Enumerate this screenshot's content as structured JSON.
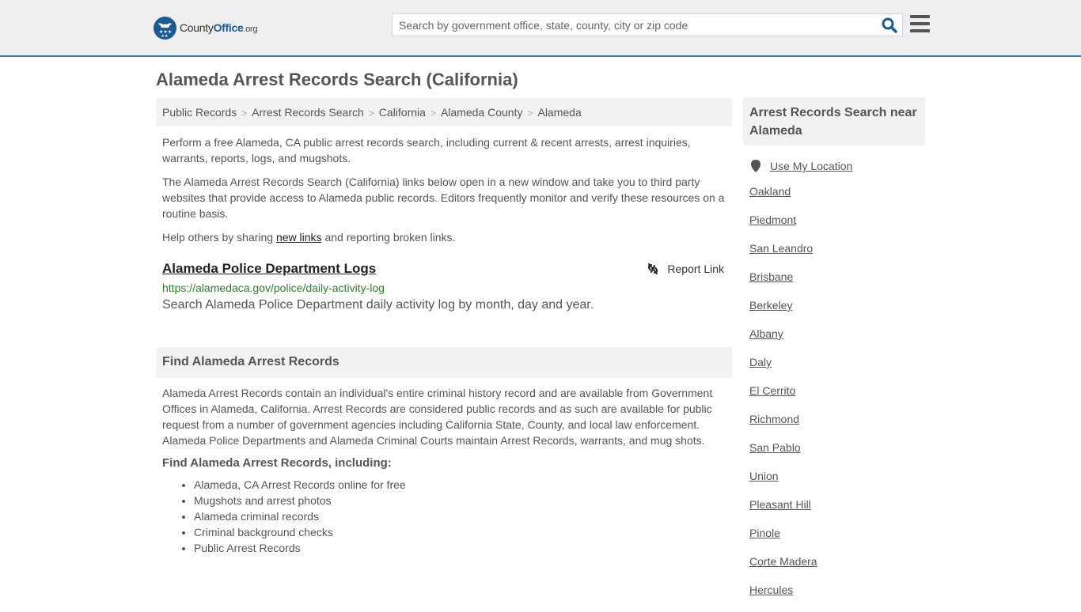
{
  "header": {
    "logo": {
      "part1": "County",
      "part2": "Office",
      "part3": ".org"
    },
    "search": {
      "placeholder": "Search by government office, state, county, city or zip code",
      "value": ""
    },
    "colors": {
      "brand": "#1b5a98",
      "accent_border": "#3a7aa8"
    }
  },
  "page": {
    "title": "Alameda Arrest Records Search (California)"
  },
  "breadcrumb": [
    {
      "label": "Public Records"
    },
    {
      "label": "Arrest Records Search"
    },
    {
      "label": "California"
    },
    {
      "label": "Alameda County"
    },
    {
      "label": "Alameda"
    }
  ],
  "intro": {
    "p1": "Perform a free Alameda, CA public arrest records search, including current & recent arrests, arrest inquiries, warrants, reports, logs, and mugshots.",
    "p2": "The Alameda Arrest Records Search (California) links below open in a new window and take you to third party websites that provide access to Alameda public records. Editors frequently monitor and verify these resources on a routine basis.",
    "p3_before": "Help others by sharing ",
    "p3_link": "new links",
    "p3_after": " and reporting broken links."
  },
  "result": {
    "title": "Alameda Police Department Logs",
    "url": "https://alamedaca.gov/police/daily-activity-log",
    "description": "Search Alameda Police Department daily activity log by month, day and year.",
    "report_label": "Report Link"
  },
  "find_section": {
    "heading": "Find Alameda Arrest Records",
    "body": "Alameda Arrest Records contain an individual's entire criminal history record and are available from Government Offices in Alameda, California. Arrest Records are considered public records and as such are available for public request from a number of government agencies including California State, County, and local law enforcement. Alameda Police Departments and Alameda Criminal Courts maintain Arrest Records, warrants, and mug shots.",
    "subheading": "Find Alameda Arrest Records, including:",
    "items": [
      "Alameda, CA Arrest Records online for free",
      "Mugshots and arrest photos",
      "Alameda criminal records",
      "Criminal background checks",
      "Public Arrest Records"
    ]
  },
  "sidebar": {
    "heading": "Arrest Records Search near Alameda",
    "use_location": "Use My Location",
    "cities": [
      "Oakland",
      "Piedmont",
      "San Leandro",
      "Brisbane",
      "Berkeley",
      "Albany",
      "Daly",
      "El Cerrito",
      "Richmond",
      "San Pablo",
      "Union",
      "Pleasant Hill",
      "Pinole",
      "Corte Madera",
      "Hercules"
    ]
  }
}
